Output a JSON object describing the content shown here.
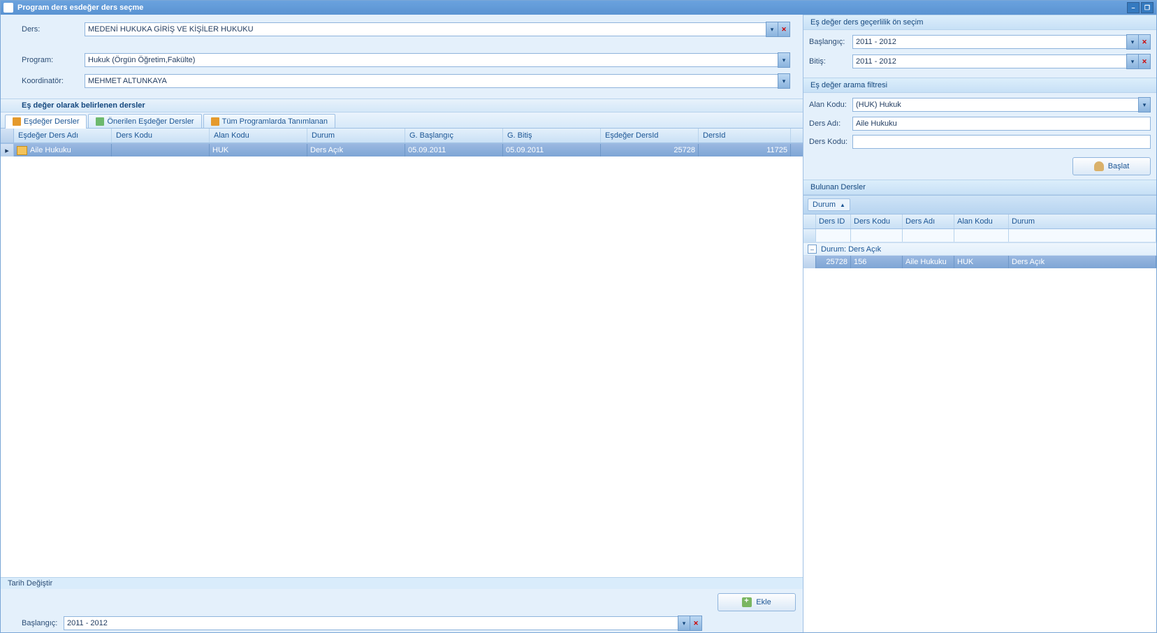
{
  "titlebar": {
    "title": "Program ders esdeğer ders seçme"
  },
  "left_form": {
    "ders_label": "Ders:",
    "ders_value": "MEDENİ HUKUKA GİRİŞ VE KİŞİLER HUKUKU",
    "program_label": "Program:",
    "program_value": "Hukuk  (Örgün Öğretim,Fakülte)",
    "koordinator_label": "Koordinatör:",
    "koordinator_value": "MEHMET ALTUNKAYA"
  },
  "section": {
    "header": "Eş değer olarak belirlenen dersler",
    "tabs": [
      {
        "label": "Eşdeğer Dersler"
      },
      {
        "label": "Önerilen Eşdeğer Dersler"
      },
      {
        "label": "Tüm Programlarda Tanımlanan"
      }
    ],
    "columns": [
      "Eşdeğer Ders Adı",
      "Ders Kodu",
      "Alan Kodu",
      "Durum",
      "G. Başlangıç",
      "G. Bitiş",
      "Eşdeğer DersId",
      "DersId"
    ],
    "rows": [
      {
        "ders_adi": "Aile Hukuku",
        "ders_kodu": "",
        "alan_kodu": "HUK",
        "durum": "Ders Açık",
        "g_baslangic": "05.09.2011",
        "g_bitis": "05.09.2011",
        "esdeger_id": "25728",
        "ders_id": "11725"
      }
    ]
  },
  "footer": {
    "tarih_degistir": "Tarih Değiştir",
    "baslangic_label": "Başlangıç:",
    "baslangic_value": "2011 - 2012",
    "ekle_label": "Ekle"
  },
  "right": {
    "panel1_title": "Eş değer ders geçerlilik ön seçim",
    "baslangic_label": "Başlangıç:",
    "baslangic_value": "2011 - 2012",
    "bitis_label": "Bitiş:",
    "bitis_value": "2011 - 2012",
    "panel2_title": "Eş değer arama filtresi",
    "alan_kodu_label": "Alan Kodu:",
    "alan_kodu_value": "(HUK) Hukuk",
    "ders_adi_label": "Ders Adı:",
    "ders_adi_value": "Aile Hukuku",
    "ders_kodu_label": "Ders Kodu:",
    "ders_kodu_value": "",
    "baslat_label": "Başlat",
    "panel3_title": "Bulunan Dersler",
    "group_chip": "Durum",
    "columns": [
      "Ders ID",
      "Ders Kodu",
      "Ders Adı",
      "Alan Kodu",
      "Durum"
    ],
    "group_row": "Durum: Ders Açık",
    "rows": [
      {
        "ders_id": "25728",
        "ders_kodu": "156",
        "ders_adi": "Aile Hukuku",
        "alan_kodu": "HUK",
        "durum": "Ders Açık"
      }
    ]
  }
}
